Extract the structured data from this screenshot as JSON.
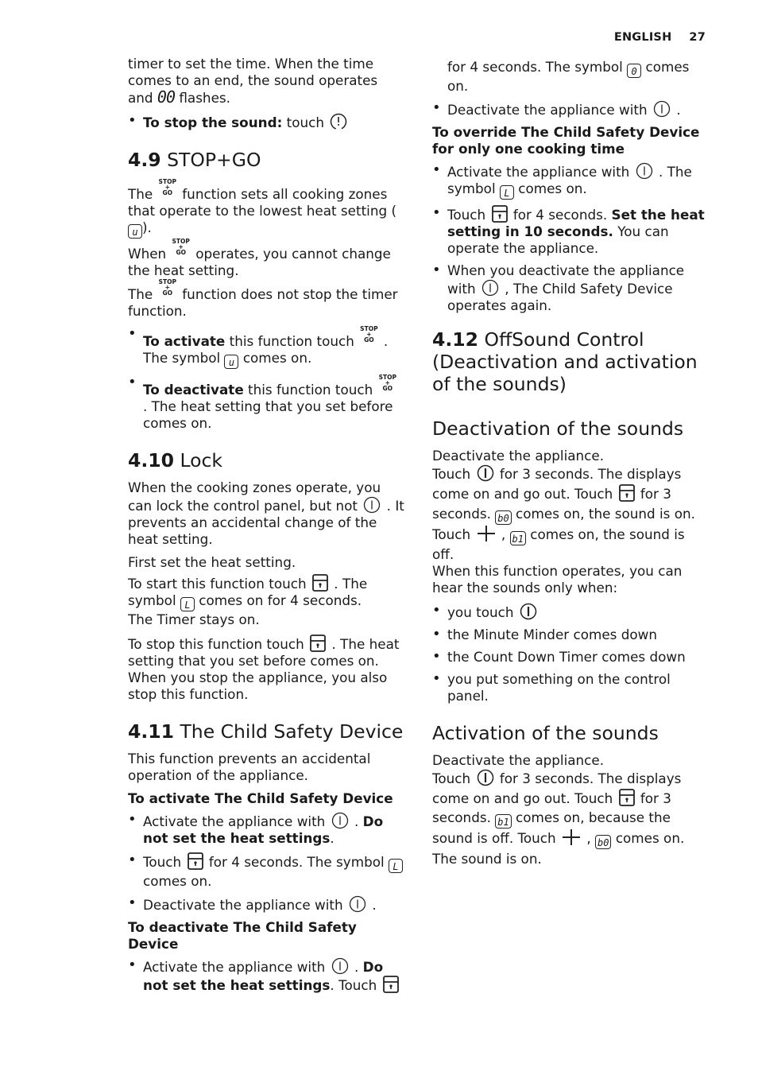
{
  "header": {
    "language": "ENGLISH",
    "page_number": "27"
  },
  "icons": {
    "power": "power-on-off-icon",
    "alert": "stop-sound-icon",
    "lock": "lock-icon",
    "stopgo": "stop-go-icon",
    "plus": "plus-icon",
    "display_u": "u",
    "display_L": "L",
    "display_0": "0",
    "display_00": "00",
    "display_b0": "b0",
    "display_b1": "b1",
    "stopgo_top": "STOP",
    "stopgo_mid": "+",
    "stopgo_bot": "GO"
  },
  "left": {
    "intro": {
      "text_a": "timer to set the time. When the time comes to an end, the sound operates and ",
      "text_b": " flashes.",
      "bullet_bold": "To stop the sound:",
      "bullet_text": " touch "
    },
    "s49": {
      "num": "4.9",
      "title": " STOP+GO",
      "p1a": "The ",
      "p1b": " function sets all cooking zones that operate to the lowest heat setting ( ",
      "p1c": ").",
      "p2a": "When ",
      "p2b": " operates, you cannot change the heat setting.",
      "p3a": "The ",
      "p3b": " function does not stop the timer function.",
      "b1_bold": "To activate",
      "b1a": " this function touch ",
      "b1b": " . The symbol ",
      "b1c": " comes on.",
      "b2_bold": "To deactivate",
      "b2a": " this function touch ",
      "b2b": " . The heat setting that you set before comes on."
    },
    "s410": {
      "num": "4.10",
      "title": " Lock",
      "p1a": "When the cooking zones operate, you can lock the control panel, but not ",
      "p1b": " . It prevents an accidental change of the heat setting.",
      "p2": "First set the heat setting.",
      "p3a": "To start this function touch ",
      "p3b": " . The symbol ",
      "p3c": " comes on for 4 seconds.",
      "p4": "The Timer stays on.",
      "p5a": "To stop this function touch ",
      "p5b": " . The heat setting that you set before comes on.",
      "p6": "When you stop the appliance, you also stop this function."
    },
    "s411": {
      "num": "4.11",
      "title": " The Child Safety Device",
      "p1": "This function prevents an accidental operation of the appliance.",
      "sub1": "To activate The Child Safety Device",
      "a1a": "Activate the appliance with ",
      "a1b": " . ",
      "a1_bold": "Do not set the heat settings",
      "a1c": ".",
      "a2a": "Touch ",
      "a2b": " for 4 seconds. The symbol ",
      "a2c": " comes on.",
      "a3a": "Deactivate the appliance with ",
      "a3b": " .",
      "sub2": "To deactivate The Child Safety Device",
      "d1a": "Activate the appliance with ",
      "d1b": " . ",
      "d1_bold": "Do not set the heat settings",
      "d1c": ". Touch "
    }
  },
  "right": {
    "cont": {
      "c1a": "for 4 seconds. The symbol ",
      "c1b": " comes on.",
      "c2a": "Deactivate the appliance with ",
      "c2b": " ."
    },
    "override": {
      "sub": "To override The Child Safety Device for only one cooking time",
      "o1a": "Activate the appliance with ",
      "o1b": " . The symbol ",
      "o1c": " comes on.",
      "o2a": "Touch ",
      "o2b": " for 4 seconds. ",
      "o2_bold": "Set the heat setting in 10 seconds.",
      "o2c": " You can operate the appliance.",
      "o3a": "When you deactivate the appliance with ",
      "o3b": " , The Child Safety Device operates again."
    },
    "s412": {
      "num": "4.12",
      "title": " OffSound Control (Deactivation and activation of the sounds)"
    },
    "deact": {
      "title": "Deactivation of the sounds",
      "p1": "Deactivate the appliance.",
      "p2a": "Touch ",
      "p2b": " for 3 seconds. The displays come on and go out. Touch ",
      "p2c": " for 3 seconds. ",
      "p2d": " comes on, the sound is on.",
      "p3a": "Touch ",
      "p3b": " , ",
      "p3c": " comes on, the sound is off.",
      "p4": "When this function operates, you can hear the sounds only when:",
      "bullets": {
        "b1": "you touch ",
        "b2": "the Minute Minder comes down",
        "b3": "the Count Down Timer comes down",
        "b4": "you put something on the control panel."
      }
    },
    "act": {
      "title": "Activation of the sounds",
      "p1": "Deactivate the appliance.",
      "p2a": "Touch ",
      "p2b": " for 3 seconds. The displays come on and go out. Touch ",
      "p2c": " for 3 seconds. ",
      "p2d": " comes on, because the sound is off. Touch ",
      "p2e": " , ",
      "p2f": " comes on. The sound is on."
    }
  }
}
